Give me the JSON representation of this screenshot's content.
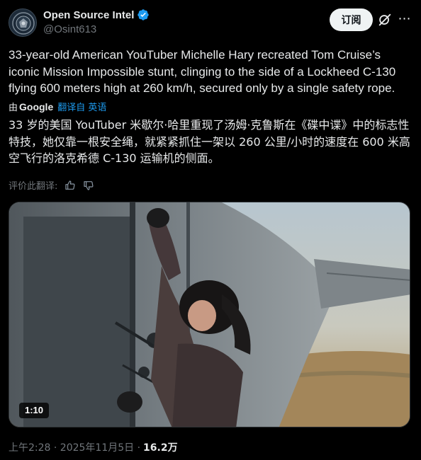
{
  "author": {
    "display_name": "Open Source Intel",
    "handle": "@Osint613",
    "avatar_icon": "seal-logo-icon",
    "verified_icon": "verified-badge-icon"
  },
  "actions": {
    "subscribe_label": "订阅",
    "grok_icon": "grok-icon",
    "more_icon": "more-icon",
    "more_glyph": "⋯"
  },
  "post": {
    "text_en": "33-year-old American YouTuber Michelle Hary recreated Tom Cruise’s iconic Mission Impossible stunt, clinging to the side of a Lockheed C-130 flying 600 meters high at 260 km/h, secured only by a single safety rope.",
    "translate_by": "由",
    "translate_provider": "Google",
    "translate_link": "翻译自 英语",
    "text_zh": "33 岁的美国 YouTuber 米歇尔·哈里重现了汤姆·克鲁斯在《碟中谍》中的标志性特技，她仅靠一根安全绳，就紧紧抓住一架以 260 公里/小时的速度在 600 米高空飞行的洛克希德 C-130 运输机的侧面。",
    "rate_label": "评价此翻译:",
    "thumbs_up_icon": "thumbs-up-icon",
    "thumbs_down_icon": "thumbs-down-icon"
  },
  "media": {
    "duration": "1:10"
  },
  "meta": {
    "time": "上午2:28 · 2025年11月5日 ·",
    "views": "16.2万"
  },
  "colors": {
    "background": "#000000",
    "text": "#e7e9ea",
    "muted": "#71767b",
    "link": "#1d9bf0",
    "verified": "#1d9bf0"
  }
}
